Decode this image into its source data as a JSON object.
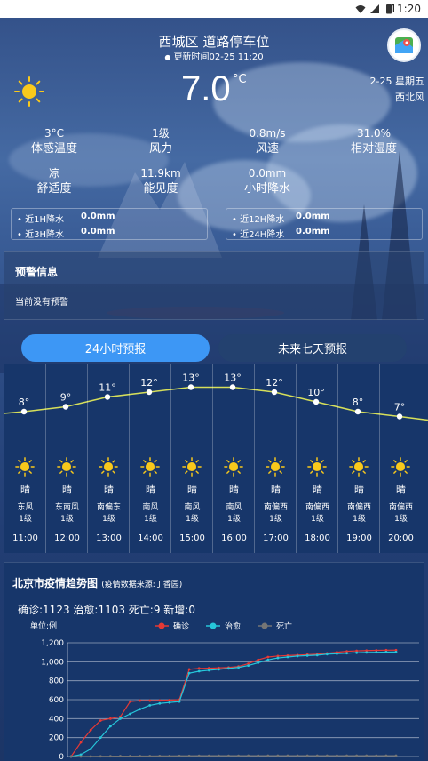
{
  "status_bar": {
    "time": "11:20"
  },
  "header": {
    "title": "西城区 道路停车位",
    "updated": "更新时间02-25 11:20",
    "date": "2-25 星期五",
    "wind_direction": "西北风"
  },
  "current": {
    "temperature": "7.0",
    "unit": "°C",
    "stats": [
      {
        "value": "3°C",
        "label": "体感温度"
      },
      {
        "value": "1级",
        "label": "风力"
      },
      {
        "value": "0.8m/s",
        "label": "风速"
      },
      {
        "value": "31.0%",
        "label": "相对湿度"
      },
      {
        "value": "凉",
        "label": "舒适度"
      },
      {
        "value": "11.9km",
        "label": "能见度"
      },
      {
        "value": "0.0mm",
        "label": "小时降水"
      }
    ],
    "rain": [
      {
        "label": "近1H降水",
        "value": "0.0mm"
      },
      {
        "label": "近3H降水",
        "value": "0.0mm"
      },
      {
        "label": "近12H降水",
        "value": "0.0mm"
      },
      {
        "label": "近24H降水",
        "value": "0.0mm"
      }
    ]
  },
  "warning": {
    "title": "预警信息",
    "text": "当前没有预警"
  },
  "tabs": {
    "hourly": "24小时预报",
    "weekly": "未来七天预报"
  },
  "hourly": [
    {
      "temp": 8,
      "cond": "晴",
      "wind": "东风",
      "level": "1级",
      "time": "11:00"
    },
    {
      "temp": 9,
      "cond": "晴",
      "wind": "东南风",
      "level": "1级",
      "time": "12:00"
    },
    {
      "temp": 11,
      "cond": "晴",
      "wind": "南偏东",
      "level": "1级",
      "time": "13:00"
    },
    {
      "temp": 12,
      "cond": "晴",
      "wind": "南风",
      "level": "1级",
      "time": "14:00"
    },
    {
      "temp": 13,
      "cond": "晴",
      "wind": "南风",
      "level": "1级",
      "time": "15:00"
    },
    {
      "temp": 13,
      "cond": "晴",
      "wind": "南风",
      "level": "1级",
      "time": "16:00"
    },
    {
      "temp": 12,
      "cond": "晴",
      "wind": "南偏西",
      "level": "1级",
      "time": "17:00"
    },
    {
      "temp": 10,
      "cond": "晴",
      "wind": "南偏西",
      "level": "1级",
      "time": "18:00"
    },
    {
      "temp": 8,
      "cond": "晴",
      "wind": "南偏西",
      "level": "1级",
      "time": "19:00"
    },
    {
      "temp": 7,
      "cond": "晴",
      "wind": "南偏西",
      "level": "1级",
      "time": "20:00"
    }
  ],
  "epidemic": {
    "title": "北京市疫情趋势图",
    "source": "(疫情数据来源:丁香园)",
    "summary": "确诊:1123 治愈:1103 死亡:9 新增:0",
    "chart_data": {
      "type": "line",
      "ylabel": "单位:例",
      "ylim": [
        0,
        1200
      ],
      "yticks": [
        "0",
        "200",
        "400",
        "600",
        "800",
        "1,000",
        "1,200"
      ],
      "legend_position": "top",
      "grid": true,
      "series": [
        {
          "name": "确诊",
          "color": "#e53935",
          "values": [
            0,
            150,
            280,
            380,
            400,
            420,
            580,
            590,
            590,
            592,
            595,
            600,
            920,
            930,
            932,
            935,
            940,
            950,
            980,
            1020,
            1050,
            1060,
            1065,
            1070,
            1075,
            1080,
            1090,
            1100,
            1110,
            1115,
            1118,
            1120,
            1122,
            1123
          ]
        },
        {
          "name": "治愈",
          "color": "#26c6da",
          "values": [
            0,
            20,
            80,
            200,
            320,
            400,
            450,
            500,
            540,
            560,
            570,
            580,
            880,
            900,
            910,
            920,
            930,
            940,
            960,
            990,
            1020,
            1040,
            1050,
            1060,
            1065,
            1070,
            1080,
            1085,
            1090,
            1095,
            1098,
            1100,
            1102,
            1103
          ]
        },
        {
          "name": "死亡",
          "color": "#757575",
          "values": [
            0,
            0,
            1,
            2,
            3,
            4,
            4,
            5,
            5,
            6,
            6,
            7,
            7,
            8,
            8,
            8,
            8,
            8,
            9,
            9,
            9,
            9,
            9,
            9,
            9,
            9,
            9,
            9,
            9,
            9,
            9,
            9,
            9,
            9
          ]
        }
      ]
    }
  }
}
